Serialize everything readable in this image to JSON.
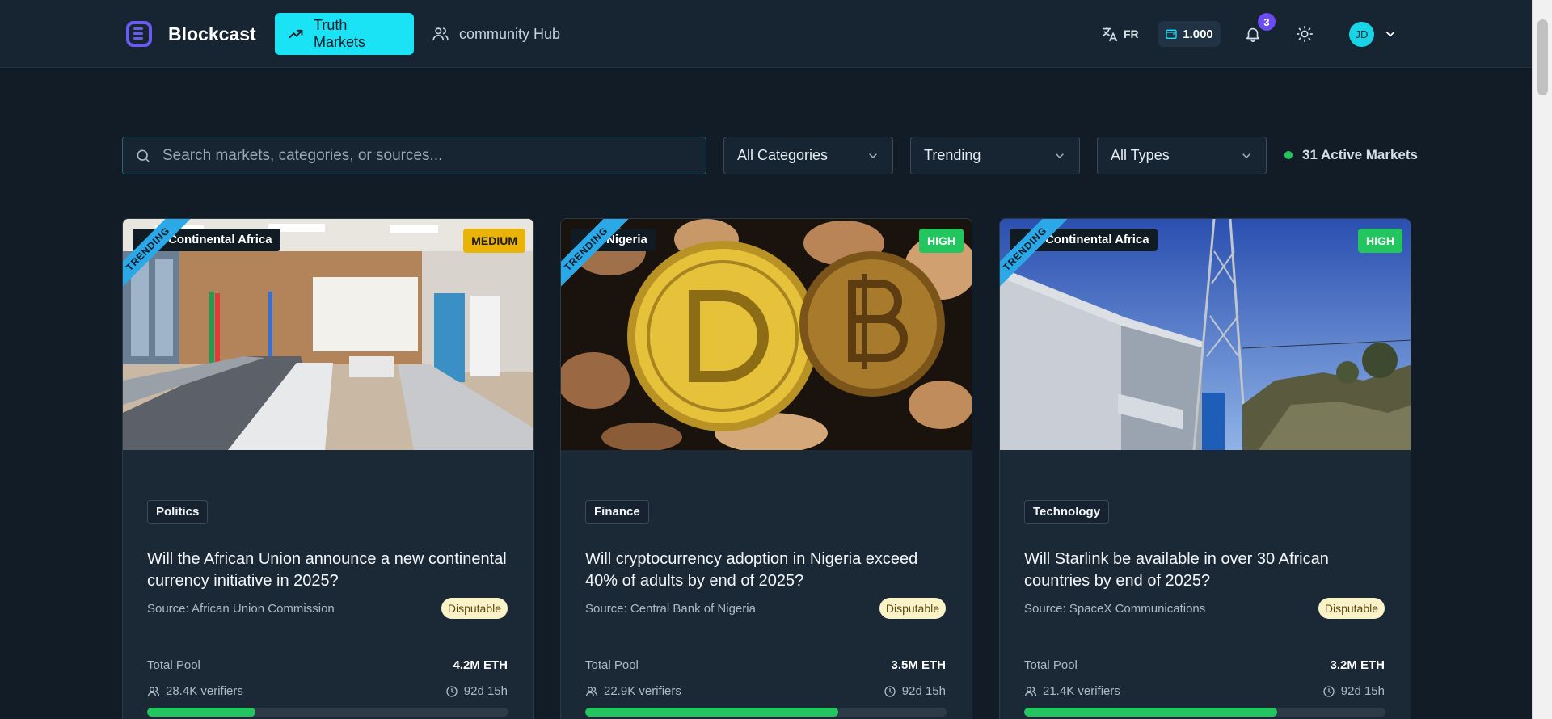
{
  "header": {
    "brand": "Blockcast",
    "nav": [
      {
        "label": "Truth Markets",
        "active": true
      },
      {
        "label": "community Hub",
        "active": false
      }
    ],
    "language": "FR",
    "wallet_balance": "1.000",
    "notification_count": "3",
    "user_initials": "JD"
  },
  "filters": {
    "search_placeholder": "Search markets, categories, or sources...",
    "category": "All Categories",
    "sort": "Trending",
    "type": "All Types",
    "active_markets": "31 Active Markets"
  },
  "markets": [
    {
      "ribbon": "TRENDING",
      "region": "Continental Africa",
      "risk": "MEDIUM",
      "category": "Politics",
      "title": "Will the African Union announce a new continental currency initiative in 2025?",
      "source": "Source: African Union Commission",
      "tag": "Disputable",
      "pool_label": "Total Pool",
      "pool": "4.2M ETH",
      "verifiers": "28.4K verifiers",
      "time_left": "92d 15h",
      "progress": 0.3
    },
    {
      "ribbon": "TRENDING",
      "region": "Nigeria",
      "risk": "HIGH",
      "category": "Finance",
      "title": "Will cryptocurrency adoption in Nigeria exceed 40% of adults by end of 2025?",
      "source": "Source: Central Bank of Nigeria",
      "tag": "Disputable",
      "pool_label": "Total Pool",
      "pool": "3.5M ETH",
      "verifiers": "22.9K verifiers",
      "time_left": "92d 15h",
      "progress": 0.7
    },
    {
      "ribbon": "TRENDING",
      "region": "Continental Africa",
      "risk": "HIGH",
      "category": "Technology",
      "title": "Will Starlink be available in over 30 African countries by end of 2025?",
      "source": "Source: SpaceX Communications",
      "tag": "Disputable",
      "pool_label": "Total Pool",
      "pool": "3.2M ETH",
      "verifiers": "21.4K verifiers",
      "time_left": "92d 15h",
      "progress": 0.7
    }
  ],
  "colors": {
    "accent": "#19e3f4",
    "brand_purple": "#6a5cf0",
    "success": "#22c55e",
    "medium_risk": "#eab308",
    "background": "#111c27"
  }
}
